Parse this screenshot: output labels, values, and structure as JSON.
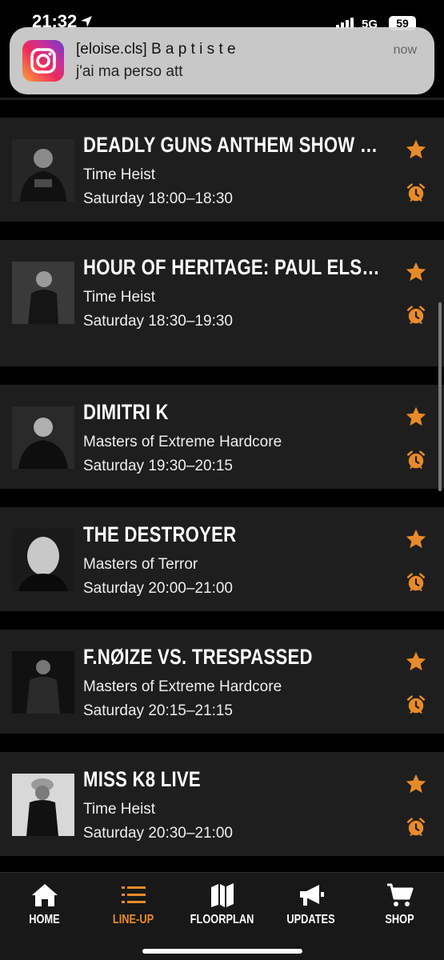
{
  "status_bar": {
    "time": "21:32",
    "network": "5G",
    "battery": "59"
  },
  "notification": {
    "app_icon": "instagram-icon",
    "title": "[eloise.cls] B a p t i s t e",
    "body": "j'ai ma perso att",
    "time": "now"
  },
  "accent_color": "#e88a2a",
  "acts": [
    {
      "title": "DEADLY GUNS ANTHEM SHOW LIVE",
      "stage": "Time Heist",
      "time": "Saturday 18:00–18:30"
    },
    {
      "title": "HOUR OF HERITAGE: PAUL ELSTAK VS. M...",
      "stage": "Time Heist",
      "time": "Saturday 18:30–19:30"
    },
    {
      "title": "DIMITRI K",
      "stage": "Masters of Extreme Hardcore",
      "time": "Saturday 19:30–20:15"
    },
    {
      "title": "THE DESTROYER",
      "stage": "Masters of Terror",
      "time": "Saturday 20:00–21:00"
    },
    {
      "title": "F.NØIZE VS. TRESPASSED",
      "stage": "Masters of Extreme Hardcore",
      "time": "Saturday 20:15–21:15"
    },
    {
      "title": "MISS K8 LIVE",
      "stage": "Time Heist",
      "time": "Saturday 20:30–21:00"
    }
  ],
  "tabs": [
    {
      "label": "HOME",
      "icon": "home-icon",
      "active": false
    },
    {
      "label": "LINE-UP",
      "icon": "lineup-list-icon",
      "active": true
    },
    {
      "label": "FLOORPLAN",
      "icon": "map-icon",
      "active": false
    },
    {
      "label": "UPDATES",
      "icon": "megaphone-icon",
      "active": false
    },
    {
      "label": "SHOP",
      "icon": "cart-icon",
      "active": false
    }
  ]
}
